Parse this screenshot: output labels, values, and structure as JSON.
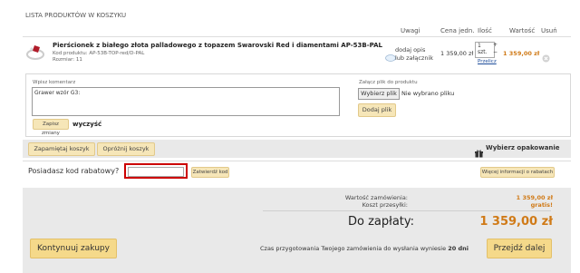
{
  "section_title": "LISTA PRODUKTÓW W KOSZYKU",
  "columns": {
    "uwagi": "Uwagi",
    "cena": "Cena jedn.",
    "ilosc": "Ilość",
    "wartosc": "Wartość",
    "usun": "Usuń"
  },
  "product": {
    "name": "Pierścionek z białego złota palladowego z topazem Swarovski Red i diamentami AP-53B-PAL",
    "code": "Kod produktu: AP-53B-TOP-red/D-PAL",
    "size": "Rozmiar: 11",
    "note_action": "dodaj opis",
    "note_action2": "lub załącznik",
    "unit_price": "1 359,00 zł",
    "quantity": "1",
    "quantity_unit": "szt.",
    "recalculate": "Przelicz",
    "total": "1 359,00 zł",
    "delete_icon": "close-icon"
  },
  "comment": {
    "label": "Wpisz komentarz",
    "value": "Grawer wzór G3:",
    "save_label": "Zapisz zmiany",
    "clear_label": "wyczyść"
  },
  "attachment": {
    "label": "Załącz plik do produktu",
    "choose_label": "Wybierz plik",
    "no_file": "Nie wybrano pliku",
    "add_label": "Dodaj plik"
  },
  "cart_actions": {
    "remember": "Zapamiętaj koszyk",
    "empty": "Opróżnij koszyk",
    "gift_icon": "gift-icon",
    "gift_wrap": "Wybierz opakowanie"
  },
  "discount": {
    "question": "Posiadasz kod rabatowy?",
    "input_value": "",
    "apply": "Zatwierdź kod",
    "more_info": "Więcej informacji o rabatach"
  },
  "summary": {
    "order_value_label": "Wartość zamówienia:",
    "order_value": "1 359,00 zł",
    "shipping_label": "Koszt przesyłki:",
    "shipping_value": "gratis!",
    "to_pay_label": "Do zapłaty:",
    "to_pay_value": "1 359,00 zł"
  },
  "footer": {
    "continue": "Kontynuuj zakupy",
    "prep_prefix": "Czas przygotowania Twojego zamówienia do wysłania wyniesie",
    "prep_days": "20 dni",
    "checkout": "Przejdź dalej"
  },
  "colors": {
    "accent": "#d07a17",
    "button": "#f6e6b8",
    "highlight_border": "#cc0000"
  }
}
